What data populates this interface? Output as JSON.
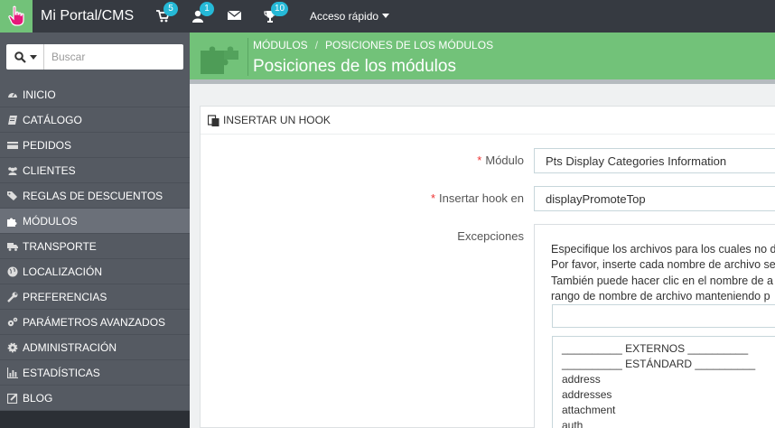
{
  "topbar": {
    "brand": "Mi Portal/CMS",
    "cart_badge": "5",
    "customers_badge": "1",
    "trophy_badge": "10",
    "quick_access": "Acceso rápido"
  },
  "sidebar": {
    "search_placeholder": "Buscar",
    "items": [
      {
        "label": "INICIO",
        "icon": "dashboard-icon"
      },
      {
        "label": "CATÁLOGO",
        "icon": "book-icon"
      },
      {
        "label": "PEDIDOS",
        "icon": "credit-card-icon"
      },
      {
        "label": "CLIENTES",
        "icon": "users-icon"
      },
      {
        "label": "REGLAS DE DESCUENTOS",
        "icon": "tags-icon"
      },
      {
        "label": "MÓDULOS",
        "icon": "puzzle-icon",
        "active": true
      },
      {
        "label": "TRANSPORTE",
        "icon": "truck-icon"
      },
      {
        "label": "LOCALIZACIÓN",
        "icon": "globe-icon"
      },
      {
        "label": "PREFERENCIAS",
        "icon": "wrench-icon"
      },
      {
        "label": "PARÁMETROS AVANZADOS",
        "icon": "cogs-icon"
      },
      {
        "label": "ADMINISTRACIÓN",
        "icon": "cog-icon"
      },
      {
        "label": "ESTADÍSTICAS",
        "icon": "bar-chart-icon"
      },
      {
        "label": "BLOG",
        "icon": "edit-icon"
      }
    ]
  },
  "header": {
    "breadcrumb": [
      "MÓDULOS",
      "POSICIONES DE LOS MÓDULOS"
    ],
    "title": "Posiciones de los módulos"
  },
  "panel": {
    "title": "INSERTAR UN HOOK",
    "module_label": "Módulo",
    "module_value": "Pts Display Categories Information",
    "hook_label": "Insertar hook en",
    "hook_value": "displayPromoteTop",
    "exceptions_label": "Excepciones",
    "help_lines": [
      "Especifique los archivos para los cuales no d",
      "Por favor, inserte cada nombre de archivo se",
      "También puede hacer clic en el nombre de a",
      "rango de nombre de archivo manteniendo p"
    ],
    "file_options": [
      "__________ EXTERNOS __________",
      "__________ ESTÁNDARD __________",
      "address",
      "addresses",
      "attachment",
      "auth"
    ]
  },
  "colors": {
    "topbar": "#363a41",
    "sidebar": "#555a62",
    "accent_green": "#72c279",
    "badge_blue": "#25b9d7",
    "required_red": "#e33333"
  }
}
